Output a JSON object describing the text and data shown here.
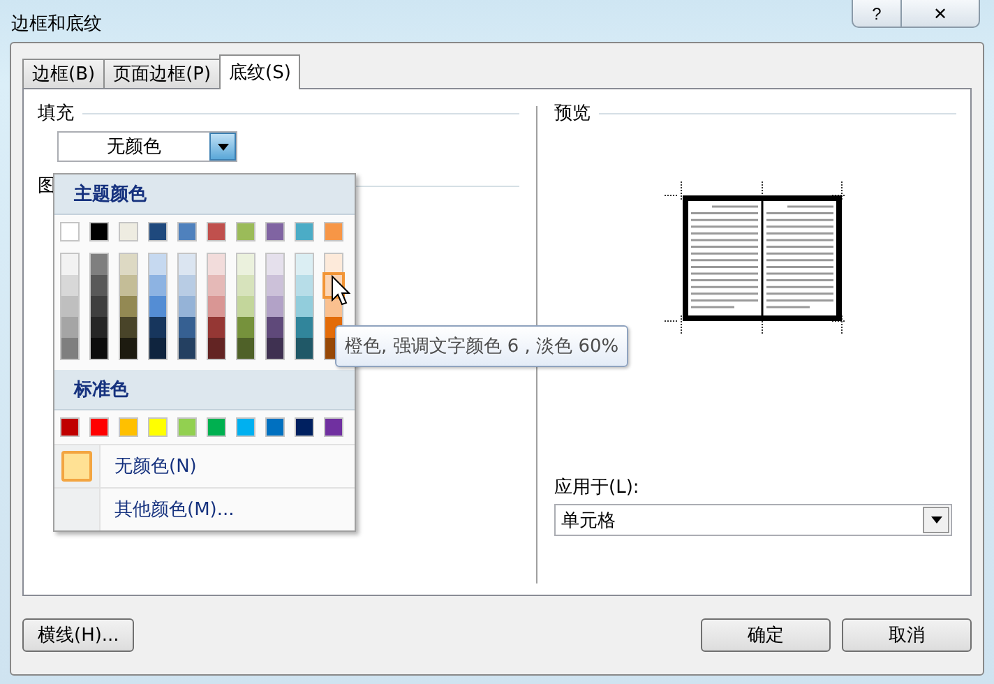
{
  "window": {
    "title": "边框和底纹",
    "help_button": "?",
    "close_button": "✕"
  },
  "tabs": [
    {
      "label": "边框(B)",
      "selected": false
    },
    {
      "label": "页面边框(P)",
      "selected": false
    },
    {
      "label": "底纹(S)",
      "selected": true
    }
  ],
  "fill": {
    "label": "填充",
    "value": "无颜色",
    "pattern_label": "图"
  },
  "color_menu": {
    "theme_heading": "主题颜色",
    "theme_colors": [
      {
        "color": "#ffffff",
        "shades": [
          {
            "color": "#f2f2f2",
            "selected": false
          },
          {
            "color": "#d8d8d8",
            "selected": false
          },
          {
            "color": "#bfbfbf",
            "selected": false
          },
          {
            "color": "#a5a5a5",
            "selected": false
          },
          {
            "color": "#7f7f7f",
            "selected": false
          }
        ]
      },
      {
        "color": "#000000",
        "shades": [
          {
            "color": "#7f7f7f",
            "selected": false
          },
          {
            "color": "#595959",
            "selected": false
          },
          {
            "color": "#3f3f3f",
            "selected": false
          },
          {
            "color": "#262626",
            "selected": false
          },
          {
            "color": "#0c0c0c",
            "selected": false
          }
        ]
      },
      {
        "color": "#eeece1",
        "shades": [
          {
            "color": "#ddd9c3",
            "selected": false
          },
          {
            "color": "#c4bd97",
            "selected": false
          },
          {
            "color": "#938953",
            "selected": false
          },
          {
            "color": "#494429",
            "selected": false
          },
          {
            "color": "#1d1b10",
            "selected": false
          }
        ]
      },
      {
        "color": "#1f497d",
        "shades": [
          {
            "color": "#c6d9f0",
            "selected": false
          },
          {
            "color": "#8db3e2",
            "selected": false
          },
          {
            "color": "#548dd4",
            "selected": false
          },
          {
            "color": "#17365d",
            "selected": false
          },
          {
            "color": "#0f243e",
            "selected": false
          }
        ]
      },
      {
        "color": "#4f81bd",
        "shades": [
          {
            "color": "#dbe5f1",
            "selected": false
          },
          {
            "color": "#b8cce4",
            "selected": false
          },
          {
            "color": "#95b3d7",
            "selected": false
          },
          {
            "color": "#366092",
            "selected": false
          },
          {
            "color": "#244061",
            "selected": false
          }
        ]
      },
      {
        "color": "#c0504d",
        "shades": [
          {
            "color": "#f2dcdb",
            "selected": false
          },
          {
            "color": "#e5b9b7",
            "selected": false
          },
          {
            "color": "#d99694",
            "selected": false
          },
          {
            "color": "#953734",
            "selected": false
          },
          {
            "color": "#632423",
            "selected": false
          }
        ]
      },
      {
        "color": "#9bbb59",
        "shades": [
          {
            "color": "#ebf1dd",
            "selected": false
          },
          {
            "color": "#d7e3bc",
            "selected": false
          },
          {
            "color": "#c3d69b",
            "selected": false
          },
          {
            "color": "#76923c",
            "selected": false
          },
          {
            "color": "#4f6128",
            "selected": false
          }
        ]
      },
      {
        "color": "#8064a2",
        "shades": [
          {
            "color": "#e5e0ec",
            "selected": false
          },
          {
            "color": "#ccc1d9",
            "selected": false
          },
          {
            "color": "#b2a2c7",
            "selected": false
          },
          {
            "color": "#5f497a",
            "selected": false
          },
          {
            "color": "#3f3151",
            "selected": false
          }
        ]
      },
      {
        "color": "#4bacc6",
        "shades": [
          {
            "color": "#dbeef3",
            "selected": false
          },
          {
            "color": "#b7dde8",
            "selected": false
          },
          {
            "color": "#92cddc",
            "selected": false
          },
          {
            "color": "#31859b",
            "selected": false
          },
          {
            "color": "#205867",
            "selected": false
          }
        ]
      },
      {
        "color": "#f79646",
        "shades": [
          {
            "color": "#fdeada",
            "selected": false
          },
          {
            "color": "#fbd5b5",
            "selected": true
          },
          {
            "color": "#fac08f",
            "selected": false
          },
          {
            "color": "#e36c09",
            "selected": false
          },
          {
            "color": "#974806",
            "selected": false
          }
        ]
      }
    ],
    "standard_heading": "标准色",
    "standard_colors": [
      {
        "color": "#c00000"
      },
      {
        "color": "#ff0000"
      },
      {
        "color": "#ffc000"
      },
      {
        "color": "#ffff00"
      },
      {
        "color": "#92d050"
      },
      {
        "color": "#00b050"
      },
      {
        "color": "#00b0f0"
      },
      {
        "color": "#0070c0"
      },
      {
        "color": "#002060"
      },
      {
        "color": "#7030a0"
      }
    ],
    "options": [
      {
        "label": "无颜色(N)",
        "selected": true
      },
      {
        "label": "其他颜色(M)...",
        "selected": false
      }
    ]
  },
  "tooltip": "橙色, 强调文字颜色 6 , 淡色 60%",
  "preview": {
    "label": "预览",
    "apply_label": "应用于(L):",
    "apply_value": "单元格"
  },
  "buttons": {
    "horizontal_line": "横线(H)...",
    "ok": "确定",
    "cancel": "取消"
  }
}
